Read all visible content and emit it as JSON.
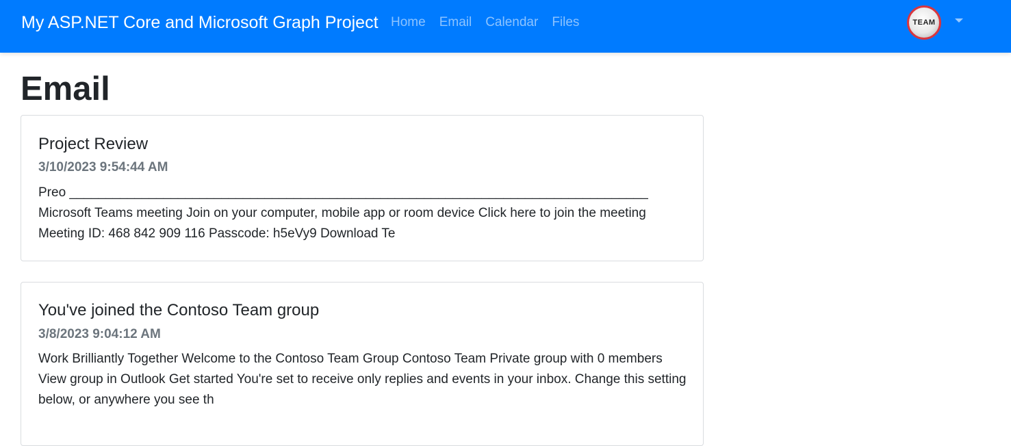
{
  "navbar": {
    "brand": "My ASP.NET Core and Microsoft Graph Project",
    "links": [
      {
        "label": "Home"
      },
      {
        "label": "Email"
      },
      {
        "label": "Calendar"
      },
      {
        "label": "Files"
      }
    ],
    "avatar_text": "TEAM",
    "accent_color": "#007bff"
  },
  "page": {
    "title": "Email"
  },
  "messages": [
    {
      "subject": "Project Review",
      "received": "3/10/2023 9:54:44 AM",
      "preview": "Preo ________________________________________________________________________________ Microsoft Teams meeting Join on your computer, mobile app or room device Click here to join the meeting Meeting ID: 468 842 909 116 Passcode: h5eVy9 Download Te"
    },
    {
      "subject": "You've joined the Contoso Team group",
      "received": "3/8/2023 9:04:12 AM",
      "preview": "Work Brilliantly Together Welcome to the Contoso Team Group Contoso Team Private group with 0 members View group in Outlook Get started You're set to receive only replies and events in your inbox. Change this setting below, or anywhere you see th"
    }
  ]
}
